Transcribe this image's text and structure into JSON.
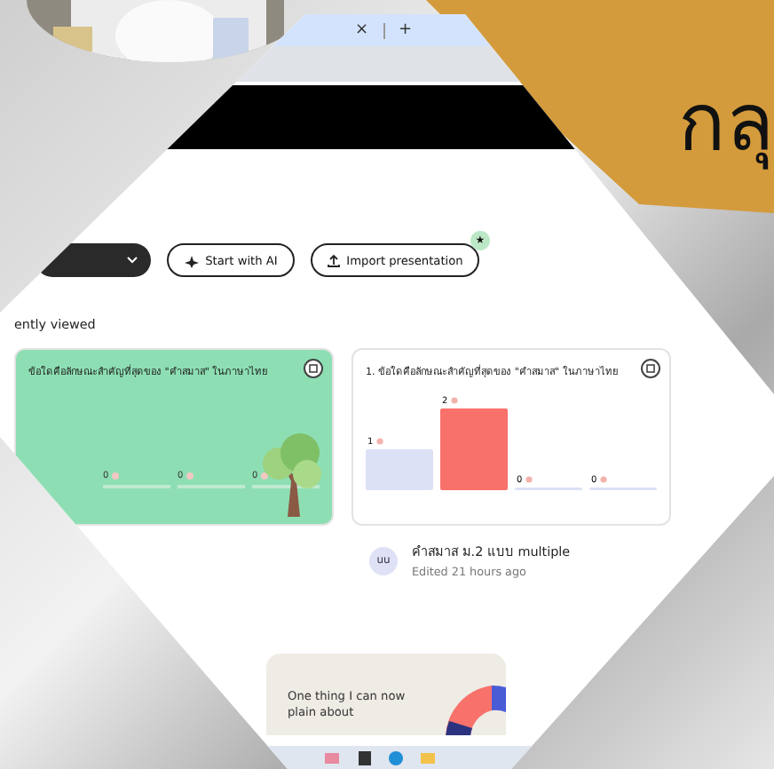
{
  "headline": "กลุ",
  "browser": {
    "tab_close": "×",
    "new_tab": "+"
  },
  "actions": [
    {
      "kind": "menu"
    },
    {
      "kind": "ai",
      "label": "Start with AI"
    },
    {
      "kind": "import",
      "label": "Import presentation",
      "badge": "★"
    }
  ],
  "section_title": "ently viewed",
  "presentations": [
    {
      "kind": "quiz",
      "thumb": {
        "title": "ข้อใดคือลักษณะสำคัญที่สุดของ \"คำสมาส\" ในภาษาไทย",
        "color": "#8ddfb3",
        "bars": [
          {
            "value_label": "0",
            "color": "#f3c7c2"
          },
          {
            "value_label": "0",
            "color": "#f3c7c2"
          },
          {
            "value_label": "0",
            "color": "#f3c7c2"
          }
        ]
      }
    },
    {
      "kind": "bars",
      "thumb": {
        "title": "1. ข้อใดคือลักษณะสำคัญที่สุดของ \"คำสมาส\" ในภาษาไทย",
        "color": "#ffffff",
        "bars": [
          {
            "value_label": "1",
            "color": "#dde1f6"
          },
          {
            "value_label": "2",
            "color": "#f8716b"
          },
          {
            "value_label": "0",
            "color": "#dde1f6"
          },
          {
            "value_label": "0",
            "color": "#dde1f6"
          }
        ]
      },
      "avatar": "uu",
      "title": "คำสมาส ม.2 แบบ multiple",
      "edited": "Edited 21 hours ago"
    }
  ],
  "popup": {
    "text": "One thing I can now plain about"
  }
}
